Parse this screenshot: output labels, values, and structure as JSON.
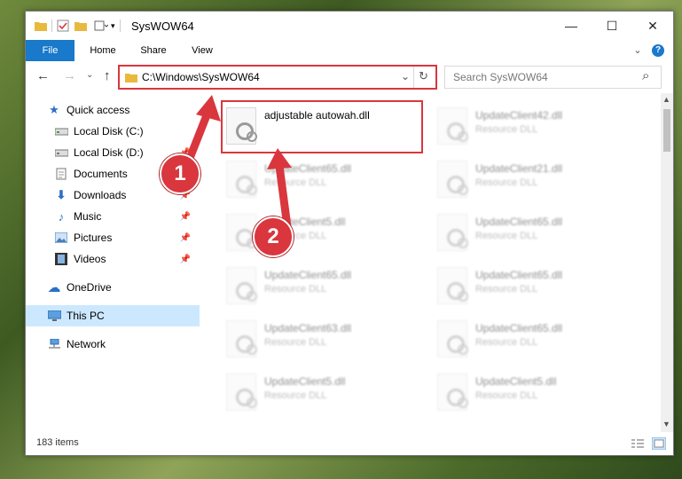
{
  "window": {
    "title": "SysWOW64",
    "controls": {
      "minimize": "—",
      "maximize": "☐",
      "close": "✕"
    }
  },
  "ribbon": {
    "tabs": [
      "File",
      "Home",
      "Share",
      "View"
    ],
    "help_icon": "?",
    "expand_icon": "⌄"
  },
  "nav": {
    "back": "←",
    "forward": "→",
    "recent": "⌄",
    "up": "↑",
    "address": "C:\\Windows\\SysWOW64",
    "address_dropdown": "⌄",
    "refresh": "↻",
    "search_placeholder": "Search SysWOW64",
    "search_icon": "⌕"
  },
  "sidebar": {
    "items": [
      {
        "label": "Quick access",
        "icon": "star-icon",
        "pinned": false
      },
      {
        "label": "Local Disk (C:)",
        "icon": "drive-icon",
        "pinned": false
      },
      {
        "label": "Local Disk (D:)",
        "icon": "drive-icon",
        "pinned": true
      },
      {
        "label": "Documents",
        "icon": "documents-icon",
        "pinned": true
      },
      {
        "label": "Downloads",
        "icon": "download-icon",
        "pinned": true
      },
      {
        "label": "Music",
        "icon": "music-icon",
        "pinned": true
      },
      {
        "label": "Pictures",
        "icon": "pictures-icon",
        "pinned": true
      },
      {
        "label": "Videos",
        "icon": "videos-icon",
        "pinned": true
      },
      {
        "label": "OneDrive",
        "icon": "cloud-icon",
        "pinned": false
      },
      {
        "label": "This PC",
        "icon": "pc-icon",
        "pinned": false
      },
      {
        "label": "Network",
        "icon": "network-icon",
        "pinned": false
      }
    ],
    "pin_glyph": "📌"
  },
  "files": [
    {
      "name": "adjustable autowah.dll",
      "type": ""
    },
    {
      "name": "UpdateClient42.dll",
      "type": "Resource DLL"
    },
    {
      "name": "UpdateClient65.dll",
      "type": "Resource DLL"
    },
    {
      "name": "UpdateClient21.dll",
      "type": "Resource DLL"
    },
    {
      "name": "UpdateClient5.dll",
      "type": "Resource DLL"
    },
    {
      "name": "UpdateClient65.dll",
      "type": "Resource DLL"
    },
    {
      "name": "UpdateClient65.dll",
      "type": "Resource DLL"
    },
    {
      "name": "UpdateClient65.dll",
      "type": "Resource DLL"
    },
    {
      "name": "UpdateClient63.dll",
      "type": "Resource DLL"
    },
    {
      "name": "UpdateClient65.dll",
      "type": "Resource DLL"
    },
    {
      "name": "UpdateClient5.dll",
      "type": "Resource DLL"
    },
    {
      "name": "UpdateClient5.dll",
      "type": "Resource DLL"
    }
  ],
  "status": {
    "item_count": "183 items"
  },
  "callouts": {
    "one": "1",
    "two": "2"
  },
  "colors": {
    "accent": "#1979ca",
    "highlight": "#d9363e",
    "selected": "#cce8ff"
  }
}
